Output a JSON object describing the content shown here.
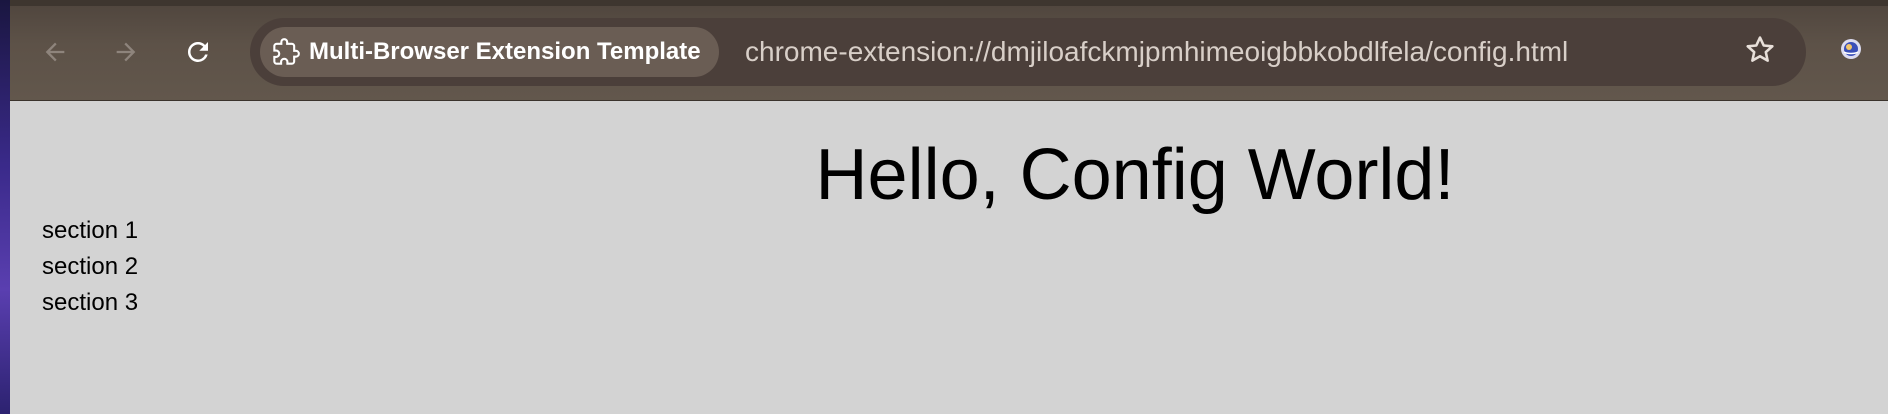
{
  "browser": {
    "nav": {
      "back_icon": "arrow-left-icon",
      "forward_icon": "arrow-right-icon",
      "reload_icon": "reload-icon"
    },
    "tab_chip": {
      "icon": "puzzle-extension-icon",
      "label": "Multi-Browser Extension Template"
    },
    "address_bar": {
      "url": "chrome-extension://dmjiloafckmjpmhimeoigbbkobdlfela/config.html"
    },
    "bookmark_icon": "star-outline-icon",
    "profile_icon": "profile-avatar-icon"
  },
  "page": {
    "heading": "Hello, Config World!",
    "sections": [
      {
        "label": "section 1"
      },
      {
        "label": "section 2"
      },
      {
        "label": "section 3"
      }
    ]
  },
  "colors": {
    "toolbar": "#5d5248",
    "omnibox": "#4b3f3a",
    "chip": "#6a5d54",
    "page_background": "#d3d3d3",
    "url_text": "#d8cfc8"
  }
}
